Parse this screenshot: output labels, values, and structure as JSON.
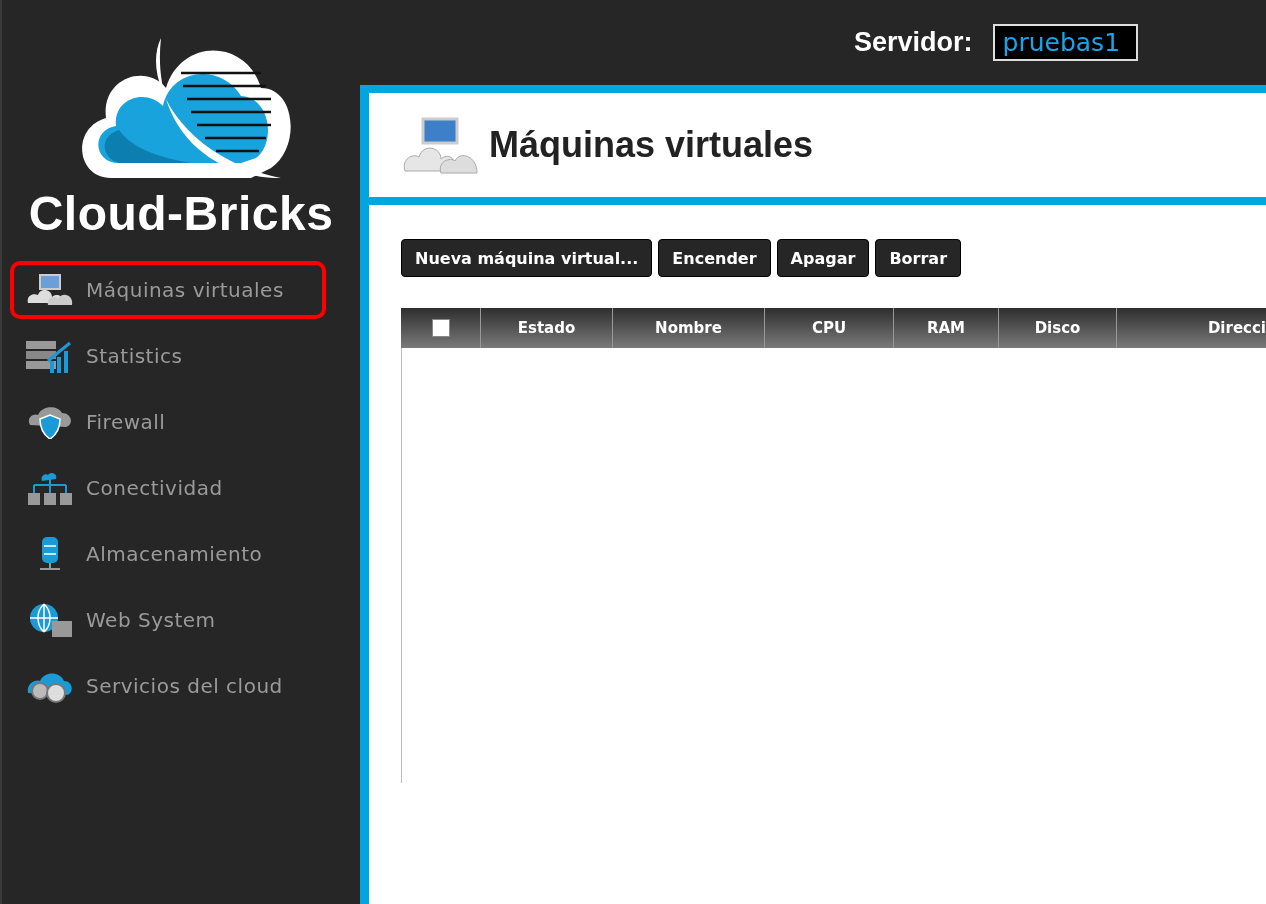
{
  "logo": {
    "name": "Cloud-Bricks"
  },
  "sidebar": {
    "items": [
      {
        "label": "Máquinas virtuales",
        "selected": true
      },
      {
        "label": "Statistics",
        "selected": false
      },
      {
        "label": "Firewall",
        "selected": false
      },
      {
        "label": "Conectividad",
        "selected": false
      },
      {
        "label": "Almacenamiento",
        "selected": false
      },
      {
        "label": "Web System",
        "selected": false
      },
      {
        "label": "Servicios del cloud",
        "selected": false
      }
    ]
  },
  "server": {
    "label": "Servidor:",
    "value": "pruebas1"
  },
  "page": {
    "title": "Máquinas virtuales"
  },
  "toolbar": {
    "buttons": [
      "Nueva máquina virtual...",
      "Encender",
      "Apagar",
      "Borrar"
    ]
  },
  "table": {
    "select_all": {
      "checked": false
    },
    "columns": [
      "Estado",
      "Nombre",
      "CPU",
      "RAM",
      "Disco",
      "Direcci"
    ]
  }
}
